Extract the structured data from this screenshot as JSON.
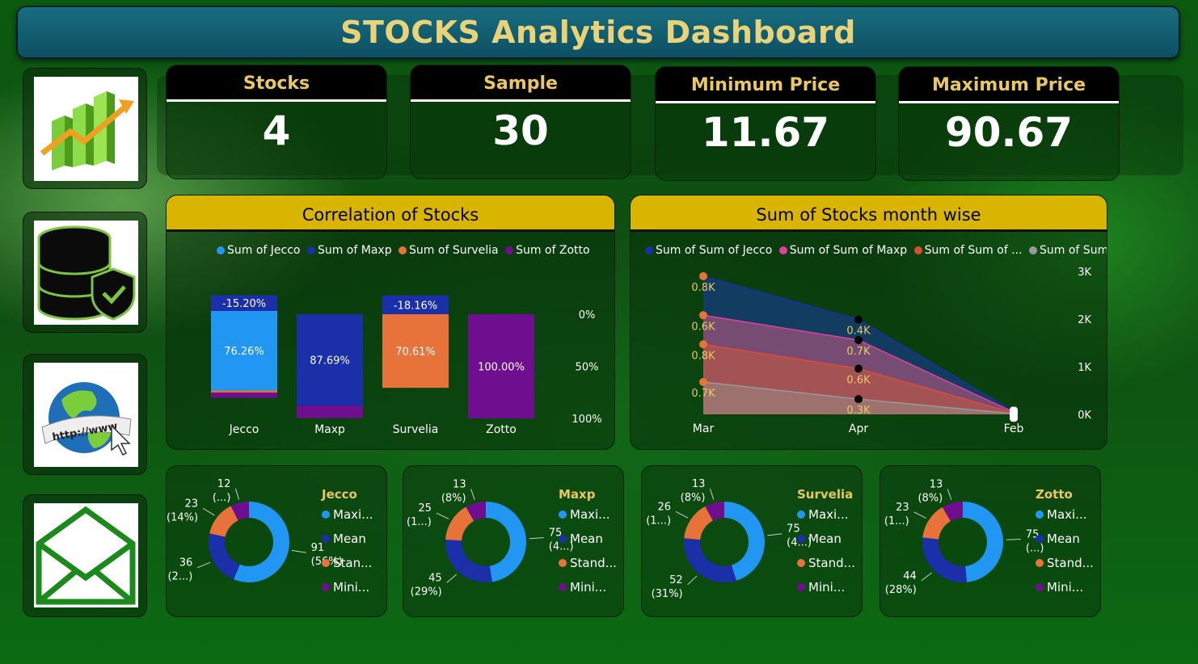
{
  "header": {
    "title": "STOCKS Analytics Dashboard"
  },
  "nav": [
    {
      "icon": "growth-chart-icon"
    },
    {
      "icon": "database-shield-icon"
    },
    {
      "icon": "globe-http-icon"
    },
    {
      "icon": "envelope-icon"
    }
  ],
  "kpis": [
    {
      "label": "Stocks",
      "value": "4"
    },
    {
      "label": "Sample",
      "value": "30"
    },
    {
      "label": "Minimum Price",
      "value": "11.67"
    },
    {
      "label": "Maximum Price",
      "value": "90.67"
    }
  ],
  "colors": {
    "jecco": "#2196f3",
    "maxp": "#1a2fa8",
    "survelia": "#e8733a",
    "zotto": "#6f0f8f",
    "accent": "#d9b400"
  },
  "chart_data": [
    {
      "type": "bar",
      "title": "Correlation of Stocks",
      "categories": [
        "Jecco",
        "Maxp",
        "Survelia",
        "Zotto"
      ],
      "legend": [
        "Sum of Jecco",
        "Sum of Maxp",
        "Sum of Survelia",
        "Sum of Zotto"
      ],
      "y_ticks": [
        "0%",
        "50%",
        "100%"
      ],
      "series": [
        {
          "name": "Sum of Jecco",
          "values": [
            76.26,
            0,
            0,
            0
          ],
          "labels": [
            "76.26%",
            "",
            "",
            ""
          ]
        },
        {
          "name": "Sum of Maxp",
          "values": [
            -15.2,
            87.69,
            -18.16,
            0
          ],
          "labels": [
            "-15.20%",
            "87.69%",
            "-18.16%",
            ""
          ]
        },
        {
          "name": "Sum of Survelia",
          "values": [
            2,
            0,
            70.61,
            0
          ],
          "labels": [
            "",
            "",
            "70.61%",
            ""
          ]
        },
        {
          "name": "Sum of Zotto",
          "values": [
            5,
            12,
            0,
            100.0
          ],
          "labels": [
            "",
            "",
            "",
            "100.00%"
          ]
        }
      ]
    },
    {
      "type": "area",
      "title": "Sum of Stocks month wise",
      "categories": [
        "Mar",
        "Apr",
        "Feb"
      ],
      "legend": [
        "Sum of Sum of Jecco",
        "Sum of Sum of Maxp",
        "Sum of Sum of ...",
        "Sum of Sum o..."
      ],
      "y_ticks": [
        "0K",
        "1K",
        "2K",
        "3K"
      ],
      "ylim": [
        0,
        3000
      ],
      "series": [
        {
          "name": "Sum of Sum of Jecco",
          "values": [
            2900,
            1990,
            60
          ],
          "labels": [
            "0.8K",
            "0.4K",
            ""
          ]
        },
        {
          "name": "Sum of Sum of Maxp",
          "values": [
            2080,
            1560,
            45
          ],
          "labels": [
            "0.6K",
            "0.7K",
            ""
          ]
        },
        {
          "name": "Sum of Sum of ...",
          "values": [
            1470,
            960,
            30
          ],
          "labels": [
            "0.8K",
            "0.6K",
            ""
          ]
        },
        {
          "name": "Sum of Sum o...",
          "values": [
            680,
            320,
            15
          ],
          "labels": [
            "0.7K",
            "0.3K",
            ""
          ]
        }
      ]
    },
    {
      "type": "pie",
      "title": "Jecco",
      "categories": [
        "Maxi...",
        "Mean",
        "Stan...",
        "Mini..."
      ],
      "values": [
        91,
        36,
        23,
        12
      ],
      "labels": [
        "91\n(56%)",
        "36\n(2...)",
        "23\n(14%)",
        "12\n(...)"
      ]
    },
    {
      "type": "pie",
      "title": "Maxp",
      "categories": [
        "Maxi...",
        "Mean",
        "Stand...",
        "Mini..."
      ],
      "values": [
        75,
        45,
        25,
        13
      ],
      "labels": [
        "75\n(4...)",
        "45\n(29%)",
        "25\n(1...)",
        "13\n(8%)"
      ]
    },
    {
      "type": "pie",
      "title": "Survelia",
      "categories": [
        "Maxi...",
        "Mean",
        "Stand...",
        "Mini..."
      ],
      "values": [
        75,
        52,
        26,
        13
      ],
      "labels": [
        "75\n(4...)",
        "52\n(31%)",
        "26\n(1...)",
        "13\n(8%)"
      ]
    },
    {
      "type": "pie",
      "title": "Zotto",
      "categories": [
        "Maxi...",
        "Mean",
        "Stand...",
        "Mini..."
      ],
      "values": [
        75,
        44,
        23,
        13
      ],
      "labels": [
        "75\n(...)",
        "44\n(28%)",
        "23\n(1...)",
        "13\n(8%)"
      ]
    }
  ]
}
